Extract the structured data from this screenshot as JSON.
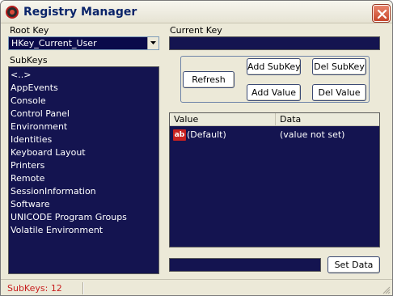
{
  "window": {
    "title": "Registry Manager"
  },
  "root_key": {
    "label": "Root Key",
    "selected": "HKey_Current_User"
  },
  "current_key": {
    "label": "Current Key",
    "value": ""
  },
  "subkeys": {
    "label": "SubKeys",
    "items": [
      "<..>",
      "AppEvents",
      "Console",
      "Control Panel",
      "Environment",
      "Identities",
      "Keyboard Layout",
      "Printers",
      "Remote",
      "SessionInformation",
      "Software",
      "UNICODE Program Groups",
      "Volatile Environment"
    ]
  },
  "buttons": {
    "refresh": "Refresh",
    "add_subkey": "Add SubKey",
    "del_subkey": "Del SubKey",
    "add_value": "Add Value",
    "del_value": "Del Value",
    "set_data": "Set Data"
  },
  "values_list": {
    "columns": [
      "Value",
      "Data"
    ],
    "rows": [
      {
        "icon": "string-value-icon",
        "icon_text": "ab",
        "name": "(Default)",
        "data": "(value not set)"
      }
    ]
  },
  "data_input": {
    "value": ""
  },
  "status": {
    "text": "SubKeys: 12"
  },
  "colors": {
    "panel_background": "#141450",
    "status_text": "#c81e1e",
    "title_text": "#0a246a"
  }
}
